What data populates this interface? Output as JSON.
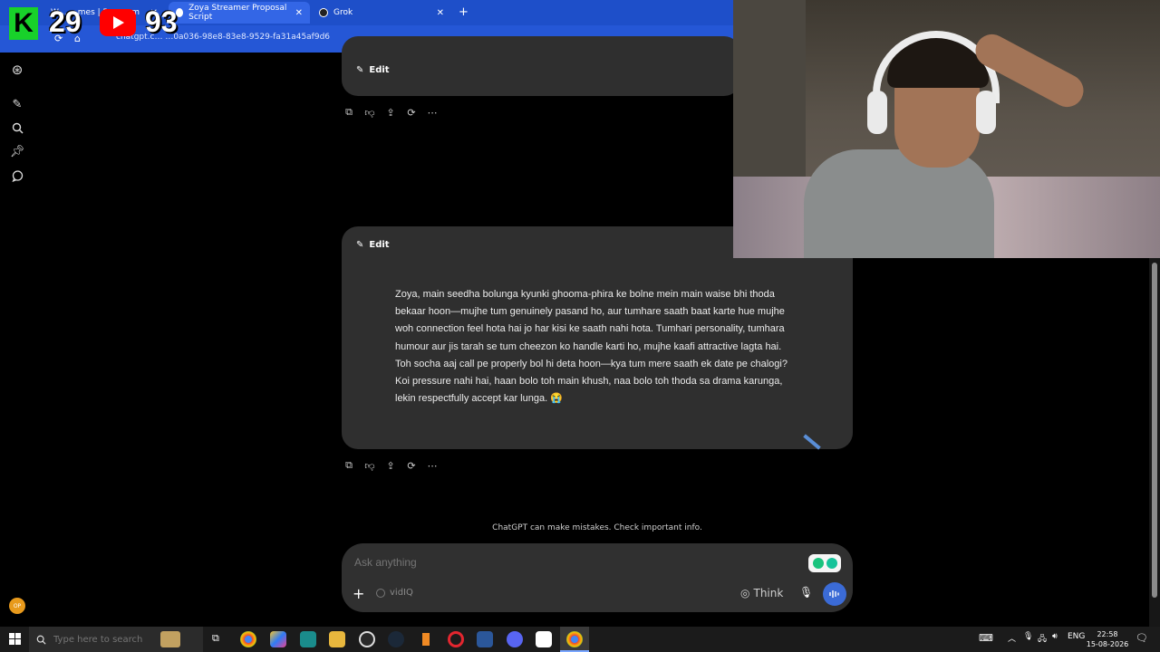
{
  "browser": {
    "tabs": [
      {
        "label": "W… …mes | P… …am"
      },
      {
        "label": "Zoya Streamer Proposal Script"
      },
      {
        "label": "Grok"
      }
    ],
    "new_tab": "+",
    "address": "chatgpt.c… …0a036-98e8-83e8-9529-fa31a45af9d6"
  },
  "overlay": {
    "k_logo": "K",
    "left_count": "29",
    "right_count": "93"
  },
  "sidebar": {
    "icons": [
      "openai-logo-icon",
      "new-chat-icon",
      "search-icon",
      "pin-icon",
      "chat-bubble-icon"
    ],
    "avatar": "OP"
  },
  "chat": {
    "edit_label_1": "Edit",
    "edit_label_2": "Edit",
    "message": "Zoya, main seedha bolunga kyunki ghooma-phira ke bolne mein main waise bhi thoda bekaar hoon—mujhe tum genuinely pasand ho, aur tumhare saath baat karte hue mujhe woh connection feel hota hai jo har kisi ke saath nahi hota. Tumhari personality, tumhara humour aur jis tarah se tum cheezon ko handle karti ho, mujhe kaafi attractive lagta hai. Toh socha aaj call pe properly bol hi deta hoon—kya tum mere saath ek date pe chalogi? Koi pressure nahi hai, haan bolo toh main khush, naa bolo toh thoda sa drama karunga, lekin respectfully accept kar lunga. 😭",
    "disclaimer": "ChatGPT can make mistakes. Check important info."
  },
  "composer": {
    "placeholder": "Ask anything",
    "plus": "+",
    "vidiq": "vidIQ",
    "think": "Think"
  },
  "taskbar": {
    "search_placeholder": "Type here to search",
    "lang": "ENG",
    "time": "22:58",
    "date": "15-08-2026"
  }
}
